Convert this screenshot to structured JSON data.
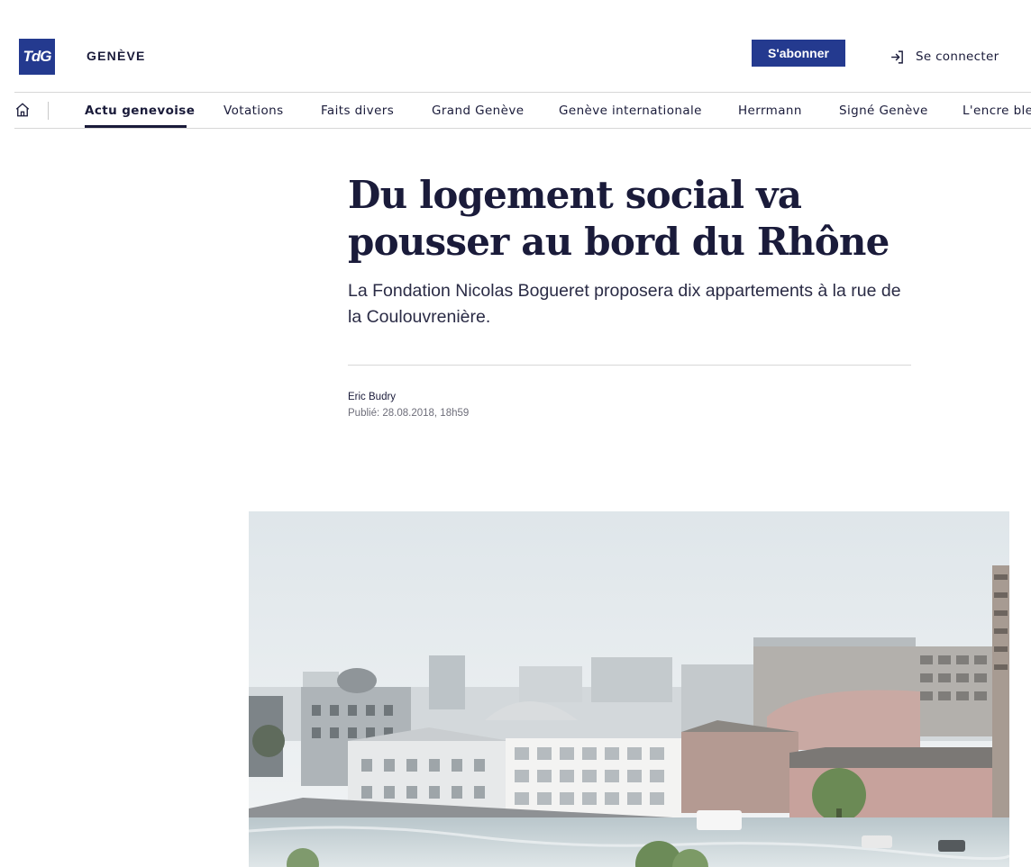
{
  "header": {
    "logo_text": "TdG",
    "section_name": "GENÈVE",
    "subscribe_label": "S'abonner",
    "login_label": "Se connecter",
    "brand_color": "#243a8f"
  },
  "nav": {
    "home_icon": "home-icon",
    "items": [
      {
        "label": "Actu genevoise",
        "active": true
      },
      {
        "label": "Votations"
      },
      {
        "label": "Faits divers"
      },
      {
        "label": "Grand Genève"
      },
      {
        "label": "Genève internationale"
      },
      {
        "label": "Herrmann"
      },
      {
        "label": "Signé Genève"
      },
      {
        "label": "L'encre ble"
      }
    ]
  },
  "article": {
    "headline": "Du logement social va pousser au bord du Rhône",
    "lead": "La Fondation Nicolas Bogueret proposera dix appartements à la rue de la Coulouvrenière.",
    "author": "Eric Budry",
    "published": "Publié: 28.08.2018, 18h59"
  }
}
